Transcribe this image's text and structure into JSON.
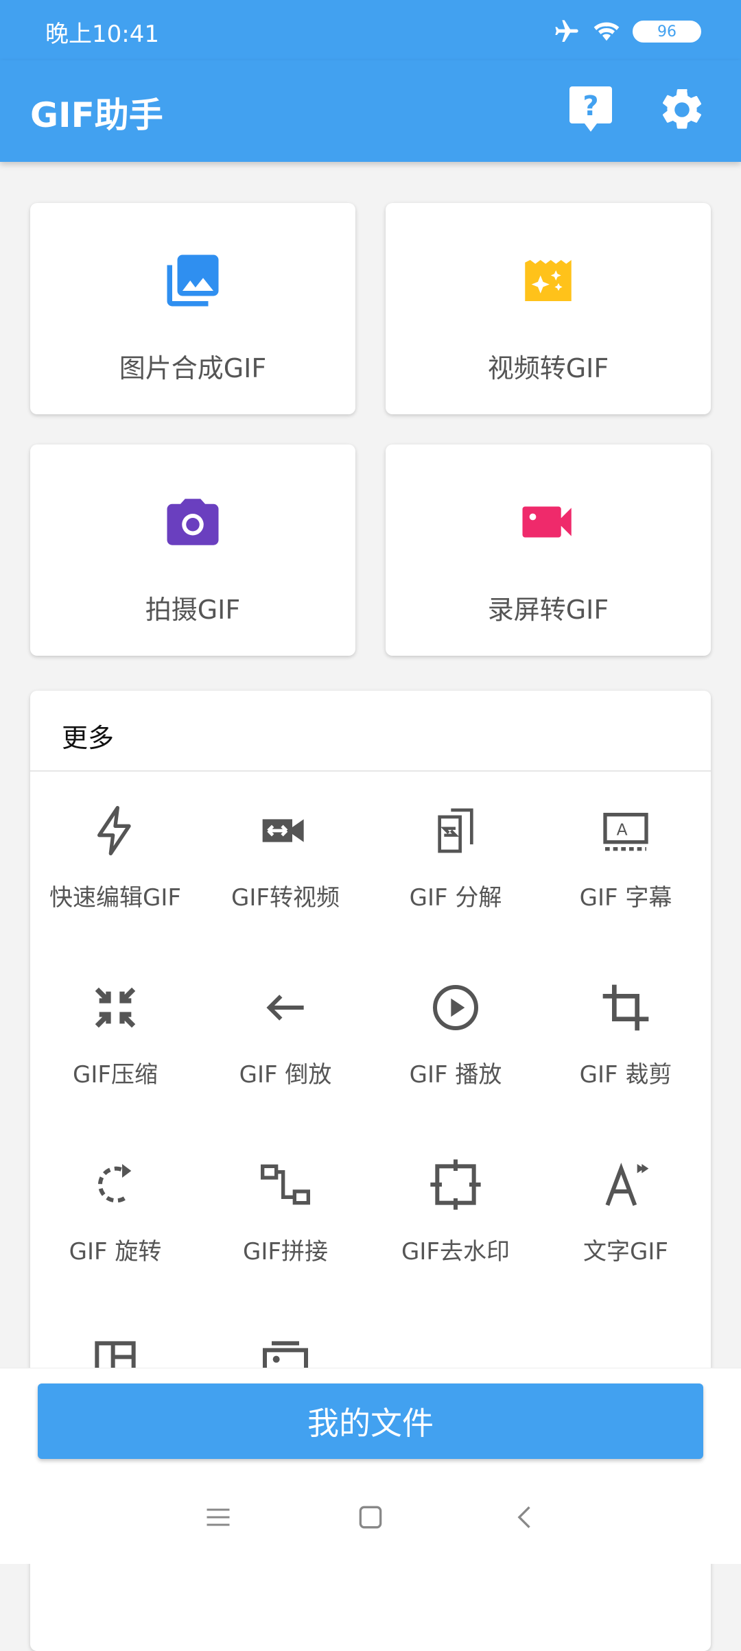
{
  "status_bar": {
    "time": "晚上10:41",
    "battery": "96"
  },
  "app_bar": {
    "title": "GIF助手"
  },
  "main_actions": [
    {
      "label": "图片合成GIF",
      "icon": "image-stack-icon",
      "color": "#2f8ff0"
    },
    {
      "label": "视频转GIF",
      "icon": "video-sparkle-icon",
      "color": "#ffc21a"
    },
    {
      "label": "拍摄GIF",
      "icon": "camera-icon",
      "color": "#6a3fbf"
    },
    {
      "label": "录屏转GIF",
      "icon": "video-camera-icon",
      "color": "#ef2a6b"
    }
  ],
  "more": {
    "title": "更多",
    "tools": [
      {
        "label": "快速编辑GIF",
        "icon": "lightning-icon"
      },
      {
        "label": "GIF转视频",
        "icon": "video-convert-icon"
      },
      {
        "label": "GIF 分解",
        "icon": "decompose-icon"
      },
      {
        "label": "GIF 字幕",
        "icon": "subtitle-icon"
      },
      {
        "label": "GIF压缩",
        "icon": "compress-icon"
      },
      {
        "label": "GIF 倒放",
        "icon": "reverse-arrow-icon"
      },
      {
        "label": "GIF 播放",
        "icon": "play-circle-icon"
      },
      {
        "label": "GIF 裁剪",
        "icon": "crop-icon"
      },
      {
        "label": "GIF 旋转",
        "icon": "rotate-icon"
      },
      {
        "label": "GIF拼接",
        "icon": "join-icon"
      },
      {
        "label": "GIF去水印",
        "icon": "remove-watermark-icon"
      },
      {
        "label": "文字GIF",
        "icon": "text-icon"
      }
    ]
  },
  "bottom": {
    "files_button": "我的文件"
  }
}
